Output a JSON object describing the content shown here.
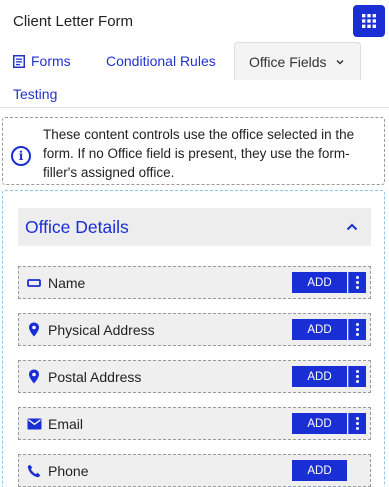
{
  "app": {
    "title": "Client Letter Form"
  },
  "header": {
    "menu_icon": "grid-icon"
  },
  "tabs": [
    {
      "label": "Forms",
      "icon": "form-list-icon"
    },
    {
      "label": "Conditional Rules"
    },
    {
      "label": "Office Fields",
      "icon": "chevron-down-icon",
      "active": true
    },
    {
      "label": "Testing"
    }
  ],
  "info": {
    "icon": "info-icon",
    "text": "These content controls use the office selected in the form. If no Office field is present, they use the form-filler's assigned office."
  },
  "section": {
    "title": "Office Details",
    "expanded": true
  },
  "fields": [
    {
      "label": "Name",
      "icon": "rectangle-icon",
      "add_label": "ADD",
      "has_more": true
    },
    {
      "label": "Physical Address",
      "icon": "location-pin-icon",
      "add_label": "ADD",
      "has_more": true
    },
    {
      "label": "Postal Address",
      "icon": "location-pin-icon",
      "add_label": "ADD",
      "has_more": true
    },
    {
      "label": "Email",
      "icon": "envelope-icon",
      "add_label": "ADD",
      "has_more": true
    },
    {
      "label": "Phone",
      "icon": "phone-icon",
      "add_label": "ADD",
      "has_more": false
    }
  ],
  "colors": {
    "accent": "#1a2ed6",
    "panel_border": "#8fc3e8",
    "row_bg": "#efefef"
  }
}
